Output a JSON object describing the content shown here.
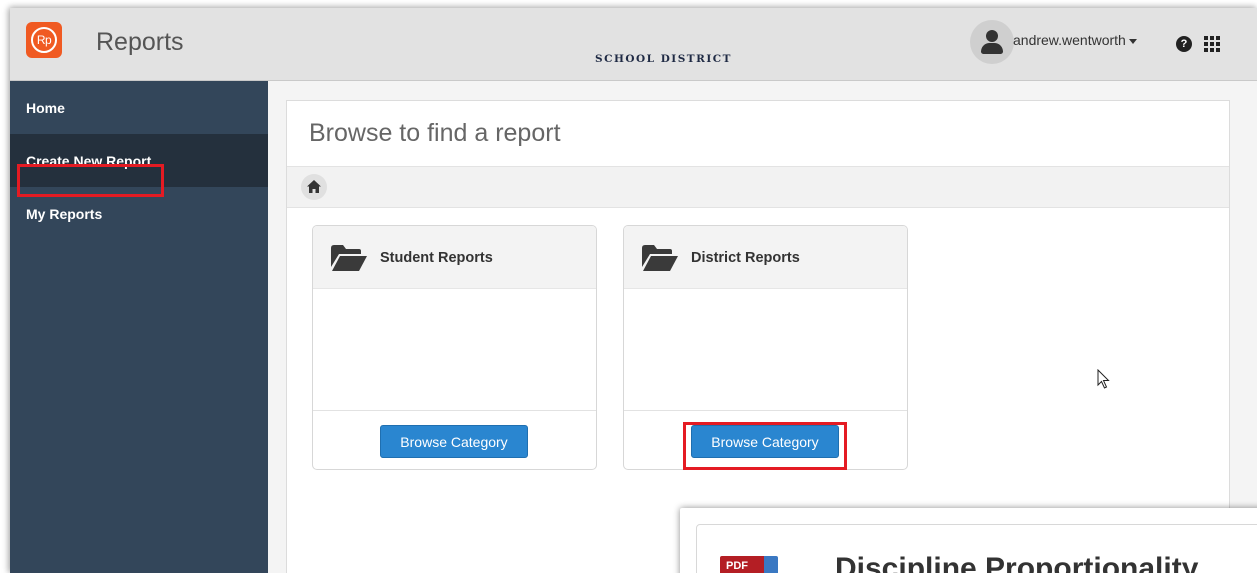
{
  "header": {
    "logo_text": "Rp",
    "app_title": "Reports",
    "district_label": "SCHOOL DISTRICT",
    "username": "andrew.wentworth",
    "help_glyph": "?"
  },
  "sidebar": {
    "items": [
      {
        "label": "Home"
      },
      {
        "label": "Create New Report"
      },
      {
        "label": "My Reports"
      }
    ]
  },
  "main": {
    "title": "Browse to find a report",
    "cards": [
      {
        "title": "Student Reports",
        "button_label": "Browse Category"
      },
      {
        "title": "District Reports",
        "button_label": "Browse Category"
      }
    ]
  },
  "overlay": {
    "pdf_label": "PDF",
    "title": "Discipline Proportionality"
  },
  "colors": {
    "header_bg": "#e2e2e2",
    "sidebar_bg": "#33465a",
    "sidebar_active": "#24303d",
    "accent_orange": "#f05a22",
    "button_blue": "#2a86d0",
    "highlight_red": "#e41b23"
  },
  "icons": [
    "user-avatar-icon",
    "help-icon",
    "app-grid-icon",
    "home-icon",
    "folder-open-icon",
    "pdf-icon",
    "mouse-cursor-icon"
  ]
}
